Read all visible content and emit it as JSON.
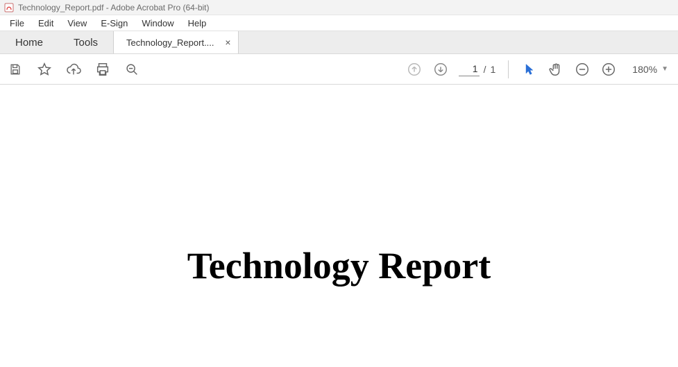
{
  "window": {
    "title": "Technology_Report.pdf - Adobe Acrobat Pro (64-bit)"
  },
  "menubar": {
    "items": [
      "File",
      "Edit",
      "View",
      "E-Sign",
      "Window",
      "Help"
    ]
  },
  "tabs": {
    "nav": [
      "Home",
      "Tools"
    ],
    "document_label": "Technology_Report...."
  },
  "toolbar": {
    "page_current": "1",
    "page_separator": "/",
    "page_total": "1",
    "zoom_level": "180%"
  },
  "document": {
    "title": "Technology Report"
  }
}
